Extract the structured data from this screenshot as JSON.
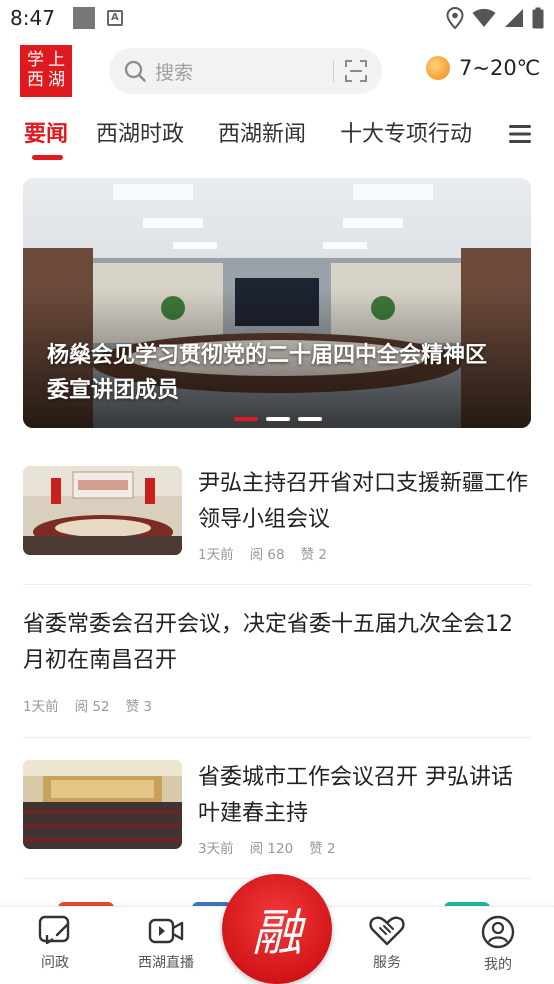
{
  "status_bar": {
    "time": "8:47"
  },
  "header": {
    "logo_chars": [
      "学",
      "上",
      "西",
      "湖"
    ],
    "search_placeholder": "搜索",
    "weather_temp": "7~20℃"
  },
  "tabs": [
    {
      "label": "要闻",
      "active": true
    },
    {
      "label": "西湖时政",
      "active": false
    },
    {
      "label": "西湖新闻",
      "active": false
    },
    {
      "label": "十大专项行动",
      "active": false
    }
  ],
  "banner": {
    "title": "杨燊会见学习贯彻党的二十届四中全会精神区委宣讲团成员",
    "slide_count": 3,
    "active_slide": 1
  },
  "news": [
    {
      "title": "尹弘主持召开省对口支援新疆工作领导小组会议",
      "time": "1天前",
      "reads": "阅 68",
      "likes": "赞 2",
      "has_image": true
    },
    {
      "title": "省委常委会召开会议，决定省委十五届九次全会12月初在南昌召开",
      "time": "1天前",
      "reads": "阅 52",
      "likes": "赞 3",
      "has_image": false
    },
    {
      "title": "省委城市工作会议召开 尹弘讲话 叶建春主持",
      "time": "3天前",
      "reads": "阅 120",
      "likes": "赞 2",
      "has_image": true
    }
  ],
  "bottom_nav": {
    "items": [
      {
        "label": "问政",
        "icon": "ask-government-icon"
      },
      {
        "label": "西湖直播",
        "icon": "video-live-icon"
      },
      {
        "label": "",
        "icon": "rong-center-icon"
      },
      {
        "label": "服务",
        "icon": "handshake-heart-icon"
      },
      {
        "label": "我的",
        "icon": "user-profile-icon"
      }
    ],
    "center_glyph": "融"
  },
  "colors": {
    "accent": "#e0191e",
    "text": "#222222",
    "meta": "#999999"
  }
}
